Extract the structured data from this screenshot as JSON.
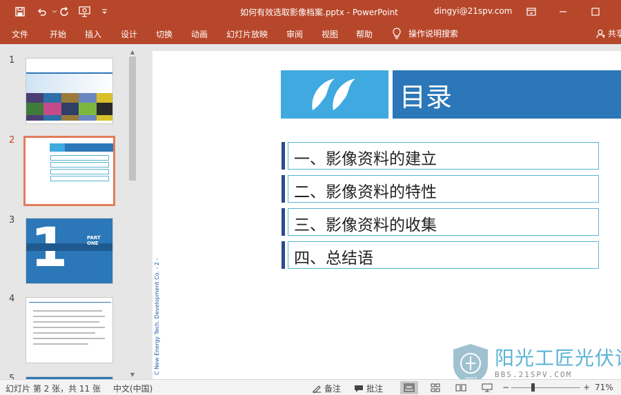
{
  "app": {
    "doc_title": "如何有效选取影像档案.pptx  -  PowerPoint",
    "user": "dingyi@21spv.com"
  },
  "quick_access": {
    "icons": [
      "save-icon",
      "undo-icon",
      "redo-icon",
      "present-icon",
      "customize-icon"
    ]
  },
  "ribbon": {
    "tabs": [
      "文件",
      "开始",
      "插入",
      "设计",
      "切换",
      "动画",
      "幻灯片放映",
      "审阅",
      "视图",
      "帮助"
    ],
    "tell_me": "操作说明搜索",
    "share": "共享"
  },
  "thumbnails": {
    "numbers": [
      "1",
      "2",
      "3",
      "4",
      "5"
    ],
    "active_index": 2,
    "slide3_part": "PART ONE"
  },
  "slide": {
    "title": "目录",
    "items": [
      "一、影像资料的建立",
      "二、影像资料的特性",
      "三、影像资料的收集",
      "四、总结语"
    ],
    "side_text": "C New Energy Tech. Development Co. - 2 -",
    "watermark_name": "阳光工匠光伏论坛",
    "watermark_url": "BBS.21SPV.COM",
    "watermark_year": "2007"
  },
  "statusbar": {
    "slide_info": "幻灯片 第 2 张，共 11 张",
    "language": "中文(中国)",
    "notes": "备注",
    "comments": "批注",
    "zoom": "71%"
  },
  "colors": {
    "ribbon": "#b7472a",
    "banner_light": "#3fa9e0",
    "banner_dark": "#2b77b8",
    "item_bar": "#2e4a8c",
    "item_border": "#56b4d3"
  }
}
